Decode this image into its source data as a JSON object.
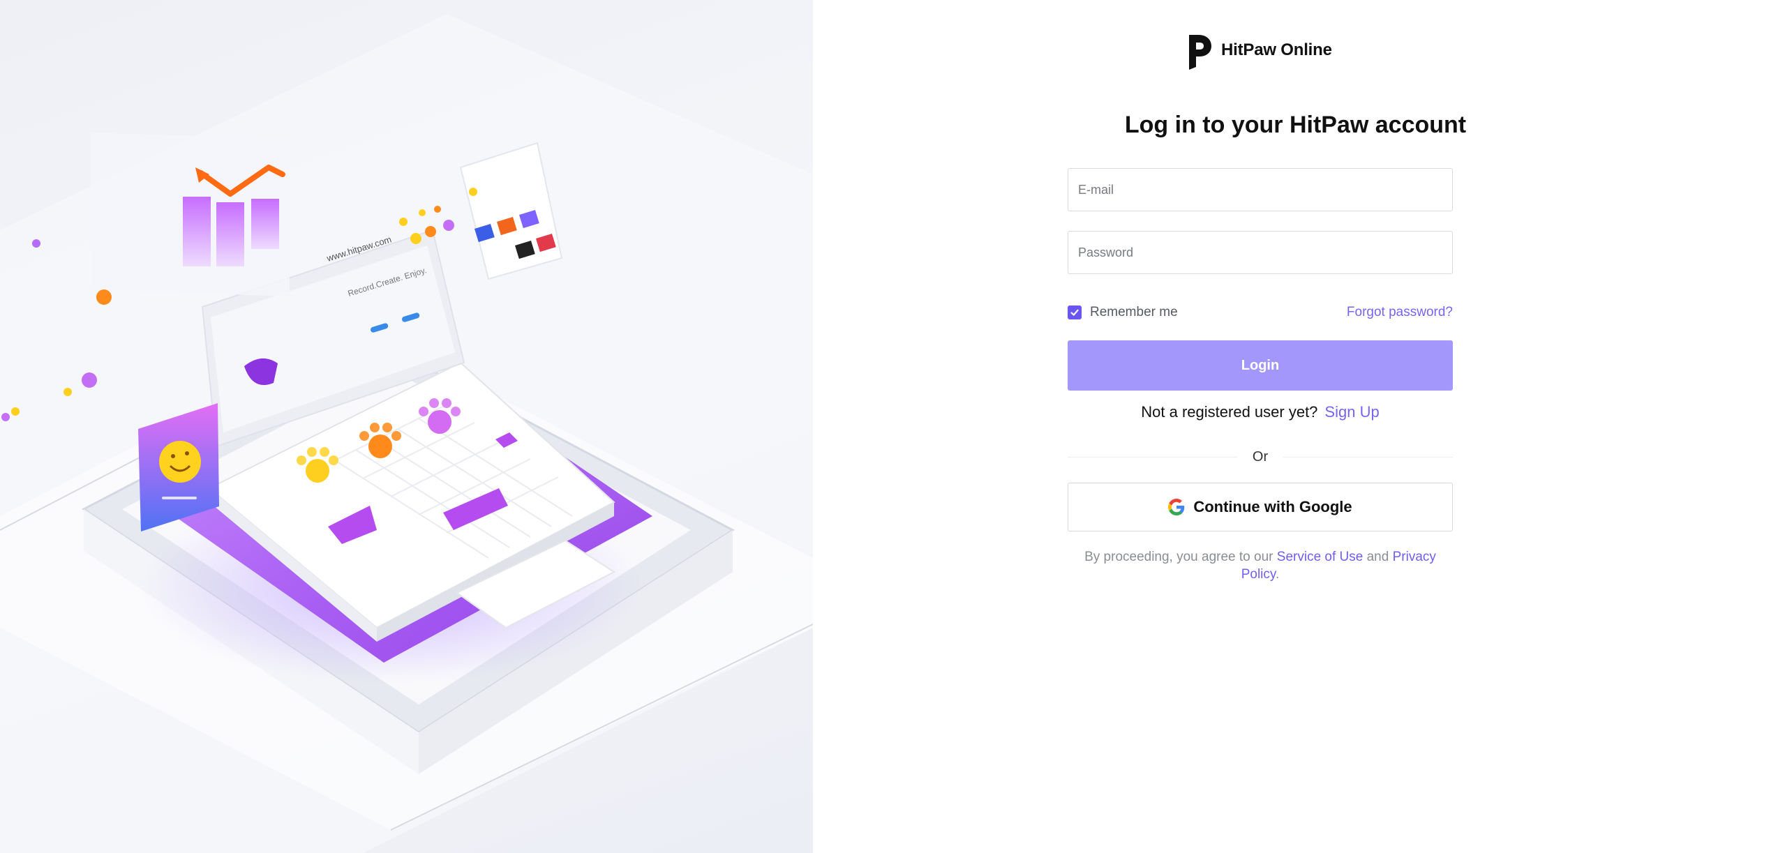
{
  "brand": {
    "name": "HitPaw Online"
  },
  "login": {
    "title": "Log in to your HitPaw account",
    "email_placeholder": "E-mail",
    "password_placeholder": "Password",
    "remember_label": "Remember me",
    "remember_checked": true,
    "forgot_label": "Forgot password?",
    "login_button": "Login",
    "register_prompt": "Not a registered user yet?",
    "signup_label": "Sign Up",
    "divider_label": "Or",
    "google_button": "Continue with Google"
  },
  "terms": {
    "prefix": "By proceeding, you agree to our",
    "service_link": "Service of Use",
    "conjunction": "and",
    "privacy_link": "Privacy Policy",
    "suffix": "."
  },
  "illustration": {
    "website_text": "www.hitpaw.com",
    "tagline": "Record.Create. Enjoy."
  },
  "colors": {
    "accent": "#7664f2",
    "login_button_bg": "#a397fb",
    "checkbox_bg": "#6a55f0",
    "illustration_purple": "#a24bf0"
  },
  "icons": {
    "brand": "hitpaw-logo-icon",
    "checkbox": "checkmark-icon",
    "google": "google-icon"
  }
}
